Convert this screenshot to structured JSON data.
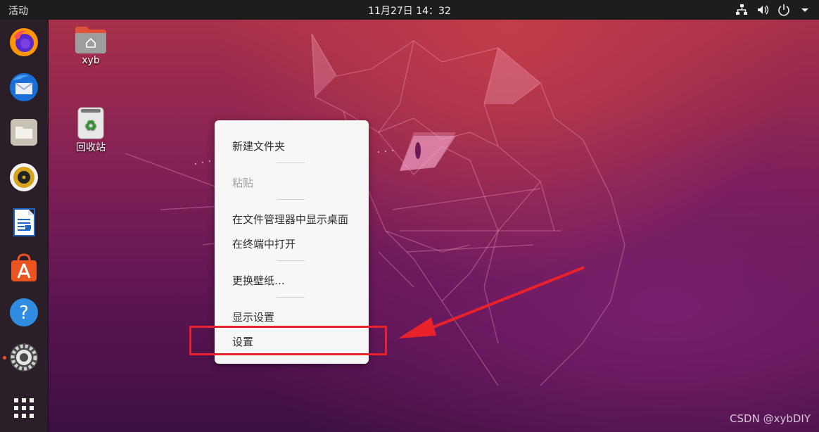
{
  "topbar": {
    "activities": "活动",
    "clock": "11月27日  14：32",
    "tray_icons": [
      "network-icon",
      "volume-icon",
      "power-icon",
      "chevron-down-icon"
    ]
  },
  "dock": {
    "items": [
      {
        "name": "firefox",
        "icon": "firefox-icon"
      },
      {
        "name": "thunderbird",
        "icon": "thunderbird-icon"
      },
      {
        "name": "files",
        "icon": "files-icon"
      },
      {
        "name": "rhythmbox",
        "icon": "rhythmbox-icon"
      },
      {
        "name": "libreoffice-writer",
        "icon": "writer-icon"
      },
      {
        "name": "software",
        "icon": "software-icon"
      },
      {
        "name": "help",
        "icon": "help-icon"
      },
      {
        "name": "settings",
        "icon": "settings-icon",
        "running": true
      }
    ],
    "show_apps": "grid-icon"
  },
  "desktop": {
    "icons": [
      {
        "label": "xyb",
        "icon": "home-folder-icon"
      },
      {
        "label": "回收站",
        "icon": "trash-icon"
      }
    ]
  },
  "context_menu": {
    "items": [
      {
        "label": "新建文件夹",
        "enabled": true
      },
      {
        "label": "粘贴",
        "enabled": false
      },
      {
        "label": "在文件管理器中显示桌面",
        "enabled": true
      },
      {
        "label": "在终端中打开",
        "enabled": true
      },
      {
        "label": "更换壁纸…",
        "enabled": true
      },
      {
        "label": "显示设置",
        "enabled": true
      },
      {
        "label": "设置",
        "enabled": true,
        "highlighted": true
      }
    ]
  },
  "annotation": {
    "color": "#e8212a"
  },
  "watermark": "CSDN @xybDIY",
  "colors": {
    "topbar": "#1d1d1d",
    "dock": "#2a1f28",
    "accent": "#e95420",
    "menu_bg": "#f7f7f7"
  }
}
